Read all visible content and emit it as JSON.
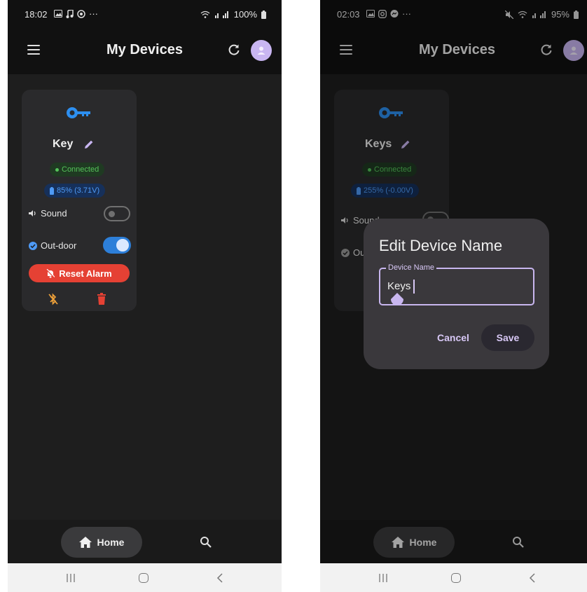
{
  "left": {
    "status": {
      "time": "18:02",
      "battery": "100%"
    },
    "appbar": {
      "title": "My Devices"
    },
    "device": {
      "name": "Key",
      "status": "Connected",
      "battery": "85% (3.71V)",
      "sound_label": "Sound",
      "sound_on": false,
      "outdoor_label": "Out-door",
      "outdoor_on": true,
      "reset_label": "Reset Alarm"
    },
    "nav": {
      "home_label": "Home"
    }
  },
  "right": {
    "status": {
      "time": "02:03",
      "battery": "95%"
    },
    "appbar": {
      "title": "My Devices"
    },
    "device": {
      "name": "Keys",
      "status": "Connected",
      "battery": "255% (-0.00V)",
      "sound_label": "Sound",
      "outdoor_label": "Out-door"
    },
    "dialog": {
      "title": "Edit Device Name",
      "field_label": "Device Name",
      "field_value": "Keys",
      "cancel_label": "Cancel",
      "save_label": "Save"
    },
    "nav": {
      "home_label": "Home"
    }
  },
  "colors": {
    "accent_blue": "#2d7fd9",
    "connected_green": "#55c35a",
    "danger_red": "#e54134",
    "bluetooth_orange": "#f0a23a",
    "dialog_purple": "#c8b6ef"
  },
  "icons": [
    "menu-icon",
    "refresh-icon",
    "avatar-icon",
    "key-icon",
    "pencil-icon",
    "battery-icon",
    "volume-icon",
    "check-circle-icon",
    "bell-off-icon",
    "bluetooth-disabled-icon",
    "trash-icon",
    "home-icon",
    "search-icon"
  ]
}
